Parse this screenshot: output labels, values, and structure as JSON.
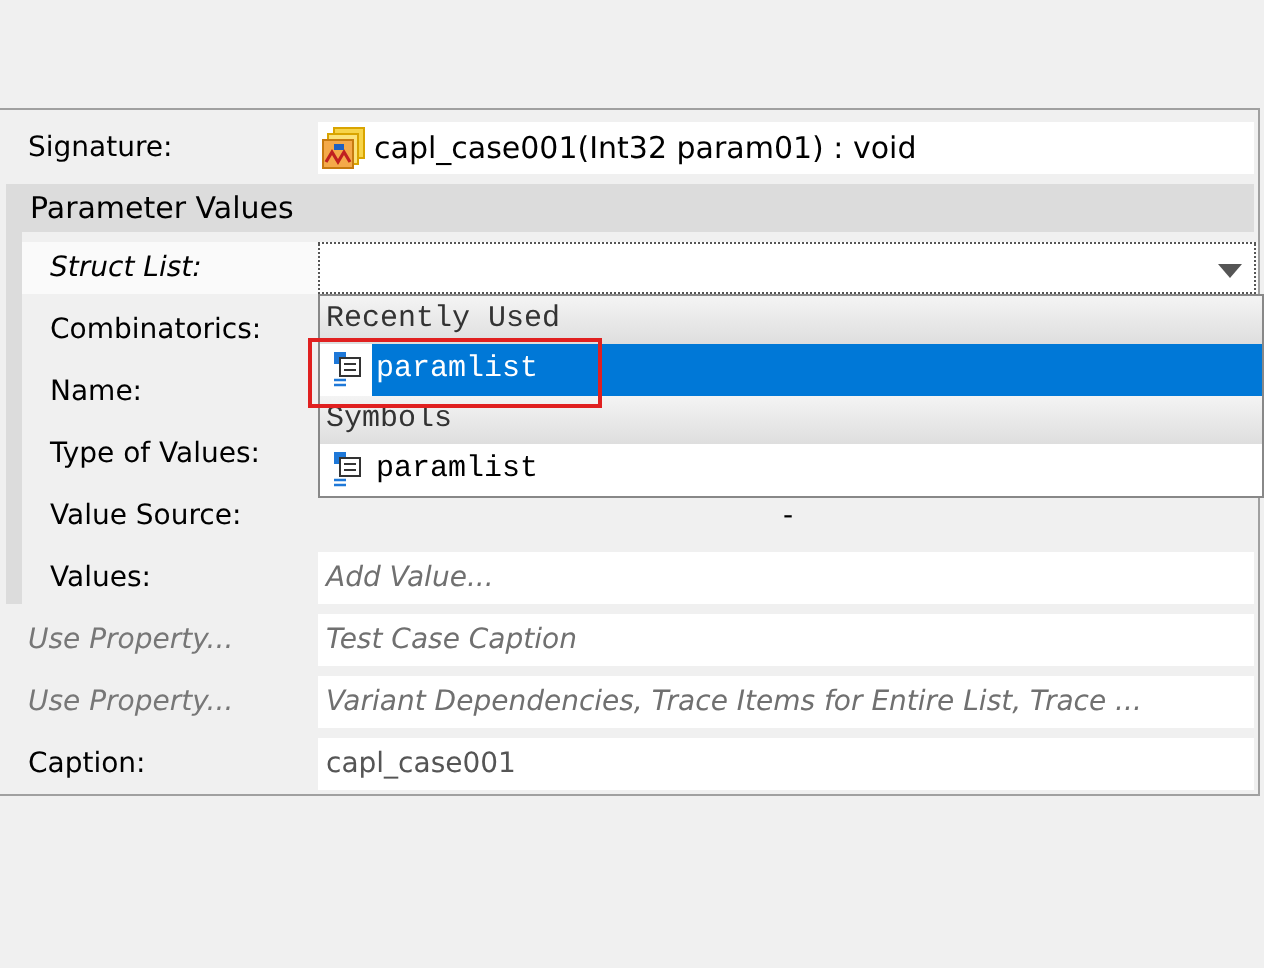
{
  "signature": {
    "label": "Signature:",
    "value": "capl_case001(Int32 param01) : void"
  },
  "section": {
    "title": "Parameter Values",
    "rows": [
      {
        "label": "Struct List:",
        "italic": true,
        "greyed": false,
        "kind": "combo"
      },
      {
        "label": "Combinatorics:",
        "italic": false,
        "greyed": false,
        "kind": "covered"
      },
      {
        "label": "Name:",
        "italic": false,
        "greyed": false,
        "kind": "covered"
      },
      {
        "label": "Type of Values:",
        "italic": false,
        "greyed": false,
        "kind": "covered"
      },
      {
        "label": "Value Source:",
        "italic": false,
        "greyed": false,
        "kind": "text",
        "value": "-"
      },
      {
        "label": "Values:",
        "italic": false,
        "greyed": false,
        "kind": "field",
        "placeholder": "Add Value..."
      }
    ]
  },
  "properties": [
    {
      "label": "Use Property...",
      "italic": true,
      "greyed": true,
      "kind": "field",
      "placeholder": "Test Case Caption"
    },
    {
      "label": "Use Property...",
      "italic": true,
      "greyed": true,
      "kind": "field",
      "placeholder": "Variant Dependencies, Trace Items for Entire List, Trace ..."
    },
    {
      "label": "Caption:",
      "italic": false,
      "greyed": false,
      "kind": "field",
      "value": "capl_case001"
    }
  ],
  "dropdown": {
    "groups": [
      {
        "title": "Recently Used",
        "items": [
          {
            "label": "paramlist",
            "selected": true,
            "highlighted": true
          }
        ]
      },
      {
        "title": "Symbols",
        "items": [
          {
            "label": "paramlist",
            "selected": false,
            "highlighted": false
          }
        ]
      }
    ]
  }
}
